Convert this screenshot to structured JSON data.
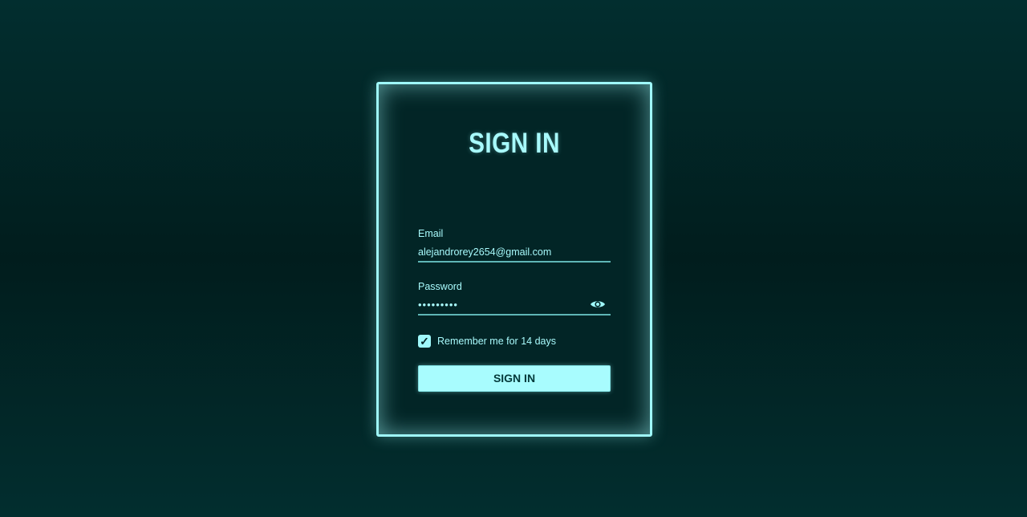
{
  "form": {
    "title": "SIGN IN",
    "email_label": "Email",
    "email_value": "alejandrorey2654@gmail.com",
    "password_label": "Password",
    "password_value": "•••••••••",
    "remember_label": "Remember me for 14 days",
    "remember_checked": true,
    "remember_mark": "✓",
    "submit_label": "SIGN IN",
    "show_password_icon": "eye-icon"
  },
  "colors": {
    "background": "#022e2f",
    "accent": "#9ff8fa",
    "card_background": "#022526",
    "button_text": "#03393a"
  }
}
